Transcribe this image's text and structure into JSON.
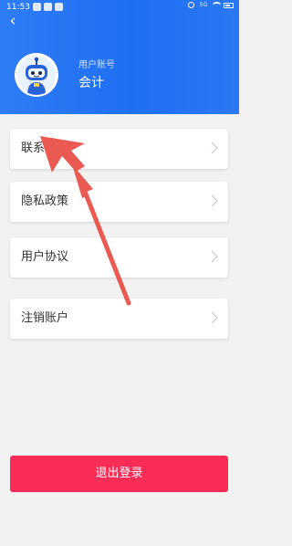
{
  "status_bar": {
    "time": "11:53",
    "network": "5G"
  },
  "header": {
    "back_icon": "chevron-left-icon",
    "account_label": "用户账号",
    "account_name": "会计"
  },
  "menu": {
    "items": [
      {
        "label": "联系客服"
      },
      {
        "label": "隐私政策"
      },
      {
        "label": "用户协议"
      },
      {
        "label": "注销账户"
      }
    ]
  },
  "logout": {
    "label": "退出登录"
  },
  "colors": {
    "header": "#1f6ff2",
    "logout": "#fb2d57",
    "annotation_arrow": "#ea5a52"
  }
}
